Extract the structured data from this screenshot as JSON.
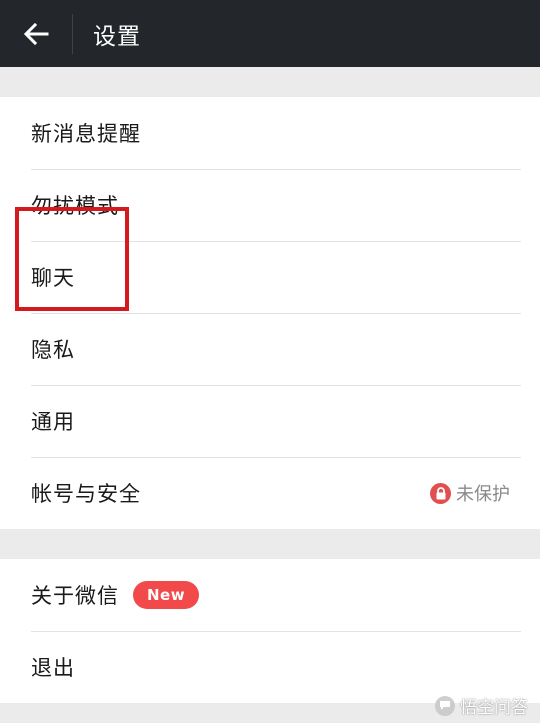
{
  "header": {
    "title": "设置",
    "back_icon": "arrow-left-icon"
  },
  "settings": {
    "group1": [
      {
        "label": "新消息提醒"
      },
      {
        "label": "勿扰模式"
      },
      {
        "label": "聊天"
      },
      {
        "label": "隐私"
      },
      {
        "label": "通用"
      },
      {
        "label": "帐号与安全",
        "status": "未保护",
        "status_icon": "lock-icon"
      }
    ],
    "group2": [
      {
        "label": "关于微信",
        "badge": "New"
      },
      {
        "label": "退出"
      }
    ]
  },
  "watermark": {
    "text": "悟空问答"
  },
  "colors": {
    "header_bg": "#23272b",
    "highlight_border": "#d21a1f",
    "badge_bg": "#f24a4a",
    "lock_bg": "#e05050"
  }
}
